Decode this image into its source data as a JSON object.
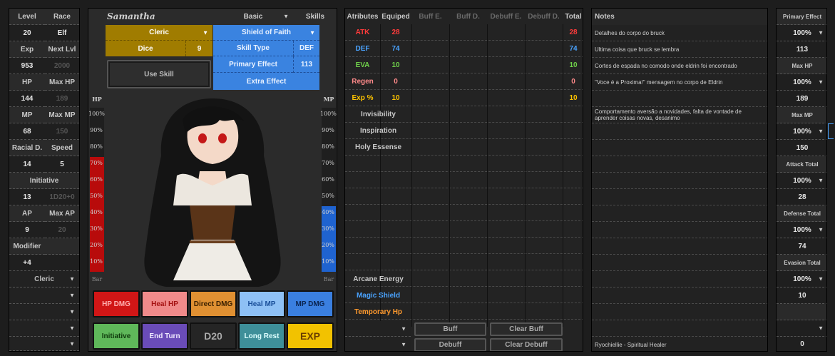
{
  "stats": {
    "level_label": "Level",
    "race_label": "Race",
    "level": "20",
    "race": "Elf",
    "exp_label": "Exp",
    "nextlvl_label": "Next Lvl",
    "exp": "953",
    "nextlvl": "2000",
    "hp_label": "HP",
    "maxhp_label": "Max HP",
    "hp": "144",
    "maxhp": "189",
    "mp_label": "MP",
    "maxmp_label": "Max MP",
    "mp": "68",
    "maxmp": "150",
    "racial_label": "Racial D.",
    "speed_label": "Speed",
    "racial": "14",
    "speed": "5",
    "initiative_label": "Initiative",
    "initiative": "13",
    "initiative_roll": "1D20+0",
    "ap_label": "AP",
    "maxap_label": "Max AP",
    "ap": "9",
    "maxap": "20",
    "modifier_label": "Modifier",
    "modifier": "+4",
    "class_select": "Cleric"
  },
  "character": {
    "name": "Samantha",
    "basic": "Basic",
    "skills": "Skills",
    "class": "Cleric",
    "skill": "Shield of Faith",
    "dice_label": "Dice",
    "dice_value": "9",
    "skilltype_label": "Skill Type",
    "skilltype_value": "DEF",
    "primary_label": "Primary Effect",
    "primary_value": "113",
    "extra_label": "Extra Effect",
    "use_skill": "Use Skill",
    "hp_bar_label": "HP",
    "mp_bar_label": "MP",
    "bar_label": "Bar",
    "hp_fill": 0.7,
    "mp_fill": 0.4,
    "percents": [
      "100%",
      "90%",
      "80%",
      "70%",
      "60%",
      "50%",
      "40%",
      "30%",
      "20%",
      "10%"
    ]
  },
  "buttons": {
    "hp_dmg": "HP DMG",
    "heal_hp": "Heal HP",
    "direct_dmg": "Direct DMG",
    "heal_mp": "Heal MP",
    "mp_dmg": "MP DMG",
    "initiative": "Initiative",
    "end_turn": "End Turn",
    "d20": "D20",
    "long_rest": "Long Rest",
    "exp": "EXP"
  },
  "attributes": {
    "headers": [
      "Atributes",
      "Equiped",
      "Buff E.",
      "Buff D.",
      "Debuff E.",
      "Debuff D.",
      "Total"
    ],
    "rows": [
      {
        "name": "ATK",
        "equiped": "28",
        "total": "28",
        "color": "#ff3b3b"
      },
      {
        "name": "DEF",
        "equiped": "74",
        "total": "74",
        "color": "#4aa3ff"
      },
      {
        "name": "EVA",
        "equiped": "10",
        "total": "10",
        "color": "#6fd04a"
      },
      {
        "name": "Regen",
        "equiped": "0",
        "total": "0",
        "color": "#ff8a8a"
      },
      {
        "name": "Exp %",
        "equiped": "10",
        "total": "10",
        "color": "#ffc400"
      }
    ],
    "effects": [
      "Invisibility",
      "Inspiration",
      "Holy Essense"
    ],
    "special": [
      {
        "name": "Arcane Energy",
        "color": "#c8c8c8"
      },
      {
        "name": "Magic Shield",
        "color": "#4aa3ff"
      },
      {
        "name": "Temporary Hp",
        "color": "#ff9a2e"
      }
    ],
    "buff": "Buff",
    "clear_buff": "Clear Buff",
    "debuff": "Debuff",
    "clear_debuff": "Clear Debuff"
  },
  "notes": {
    "title": "Notes",
    "items": [
      "Detalhes do corpo do bruck",
      "Ultima coisa que bruck se lembra",
      "Cortes de espada no comodo onde eldrin foi encontrado",
      "\"Voce é a Proxima!\" mensagem no corpo de Eldrin",
      "",
      "Comportamento aversão a novidades, falta de vontade de aprender coisas novas, desanimo"
    ],
    "footer": "Ryochiellie - Spiritual Healer"
  },
  "effects_panel": {
    "primary_label": "Primary Effect",
    "primary_pct": "100%",
    "primary_value": "113",
    "maxhp_label": "Max HP",
    "maxhp_pct": "100%",
    "maxhp_value": "189",
    "maxmp_label": "Max MP",
    "maxmp_pct": "100%",
    "maxmp_value": "150",
    "attack_label": "Attack Total",
    "attack_pct": "100%",
    "attack_value": "28",
    "defense_label": "Defense Total",
    "defense_pct": "100%",
    "defense_value": "74",
    "evasion_label": "Evasion Total",
    "evasion_pct": "100%",
    "evasion_value": "10",
    "bottom_value": "0"
  }
}
